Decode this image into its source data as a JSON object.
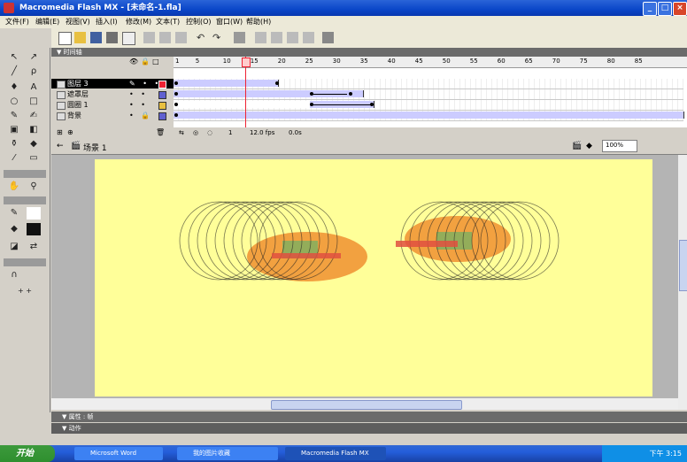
{
  "window": {
    "title": "Macromedia Flash MX - [未命名-1.fla]",
    "controls": [
      "_",
      "□",
      "×"
    ]
  },
  "menu": [
    "文件(F)",
    "编辑(E)",
    "视图(V)",
    "插入(I)",
    "修改(M)",
    "文本(T)",
    "控制(O)",
    "窗口(W)",
    "帮助(H)"
  ],
  "timeline": {
    "panel_title": "▼ 时间轴",
    "layers": [
      {
        "name": "图层 3",
        "selected": true
      },
      {
        "name": "遮罩层",
        "selected": false
      },
      {
        "name": "圆圈 1",
        "selected": false
      },
      {
        "name": "背景",
        "selected": false
      }
    ],
    "frame_numbers": [
      "1",
      "5",
      "10",
      "15",
      "20",
      "25",
      "30",
      "35",
      "40",
      "45",
      "50",
      "55",
      "60",
      "65",
      "70",
      "75",
      "80",
      "85"
    ],
    "status": [
      "1",
      "12.0 fps",
      "0.0s"
    ]
  },
  "stage": {
    "scene_label": "场景 1",
    "zoom": "100%"
  },
  "panels": {
    "properties": "▼ 属性 : 帧",
    "actions": "▼ 动作"
  },
  "colors": {
    "stage": "#ffff99",
    "accent_red": "#e23",
    "title_blue": "#0a46c8"
  },
  "taskbar": {
    "start": "开始",
    "tasks": [
      "Microsoft Word",
      "我的图片收藏",
      "Macromedia Flash MX"
    ],
    "clock": "下午 3:15"
  }
}
